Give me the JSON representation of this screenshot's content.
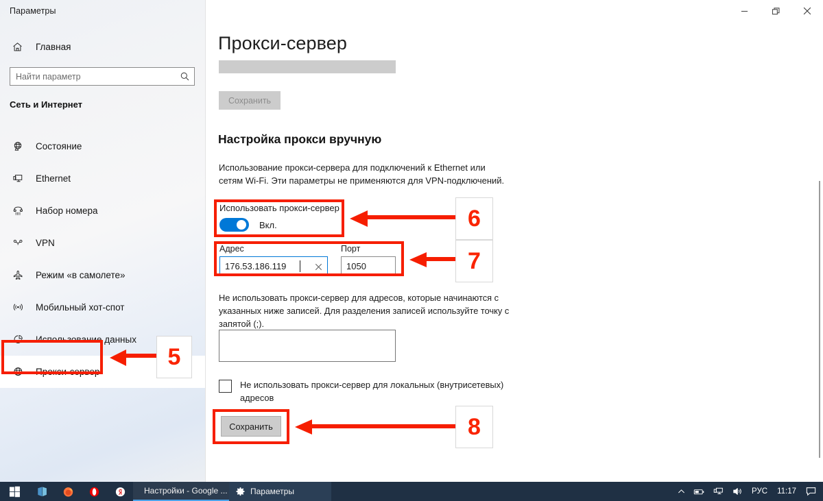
{
  "window": {
    "title": "Параметры",
    "controls": {
      "minimize": "minimize-icon",
      "restore": "restore-icon",
      "close": "close-icon"
    }
  },
  "sidebar": {
    "home": {
      "label": "Главная",
      "icon": "home-icon"
    },
    "search": {
      "placeholder": "Найти параметр",
      "value": "",
      "icon": "search-icon"
    },
    "category": "Сеть и Интернет",
    "items": [
      {
        "label": "Состояние",
        "icon": "globe-icon",
        "selected": false
      },
      {
        "label": "Ethernet",
        "icon": "monitor-icon",
        "selected": false
      },
      {
        "label": "Набор номера",
        "icon": "phone-icon",
        "selected": false
      },
      {
        "label": "VPN",
        "icon": "vpn-icon",
        "selected": false
      },
      {
        "label": "Режим «в самолете»",
        "icon": "airplane-icon",
        "selected": false
      },
      {
        "label": "Мобильный хот-спот",
        "icon": "hotspot-icon",
        "selected": false
      },
      {
        "label": "Использование данных",
        "icon": "chart-pie-icon",
        "selected": false
      },
      {
        "label": "Прокси-сервер",
        "icon": "globe-icon",
        "selected": true
      }
    ]
  },
  "main": {
    "page_title": "Прокси-сервер",
    "save_top_label": "Сохранить",
    "section_title": "Настройка прокси вручную",
    "description": "Использование прокси-сервера для подключений к Ethernet или сетям Wi-Fi. Эти параметры не применяются для VPN-подключений.",
    "toggle": {
      "caption": "Использовать прокси-сервер",
      "state_label": "Вкл.",
      "on": true
    },
    "address": {
      "label": "Адрес",
      "value": "176.53.186.119",
      "clear_icon": "clear-icon"
    },
    "port": {
      "label": "Порт",
      "value": "1050"
    },
    "exceptions": {
      "description": "Не использовать прокси-сервер для адресов, которые начинаются с указанных ниже записей. Для разделения записей используйте точку с запятой (;).",
      "value": ""
    },
    "local_bypass": {
      "label": "Не использовать прокси-сервер для локальных (внутрисетевых) адресов",
      "checked": false
    },
    "save_bottom_label": "Сохранить"
  },
  "annotations": [
    {
      "number": "5",
      "target": "sidebar-item-proxy"
    },
    {
      "number": "6",
      "target": "use-proxy-toggle"
    },
    {
      "number": "7",
      "target": "address-port-fields"
    },
    {
      "number": "8",
      "target": "save-button-bottom"
    }
  ],
  "colors": {
    "accent": "#0078d7",
    "annotation": "#f61e00",
    "annotation_number": "#fa2400",
    "taskbar": "#1f3044"
  },
  "taskbar": {
    "start": "windows-start-icon",
    "pinned": [
      {
        "name": "store-icon"
      },
      {
        "name": "firefox-icon"
      },
      {
        "name": "opera-icon"
      },
      {
        "name": "yandex-browser-icon"
      }
    ],
    "tasks": [
      {
        "label": "Настройки - Google ...",
        "icon": "chrome-icon",
        "active": false
      },
      {
        "label": "Параметры",
        "icon": "settings-gear-icon",
        "active": true
      }
    ],
    "tray": {
      "expand": "chevron-up-icon",
      "icons": [
        "battery-icon",
        "network-icon",
        "volume-icon"
      ],
      "language": "РУС",
      "clock": "11:17",
      "action_center": "action-center-icon"
    }
  }
}
